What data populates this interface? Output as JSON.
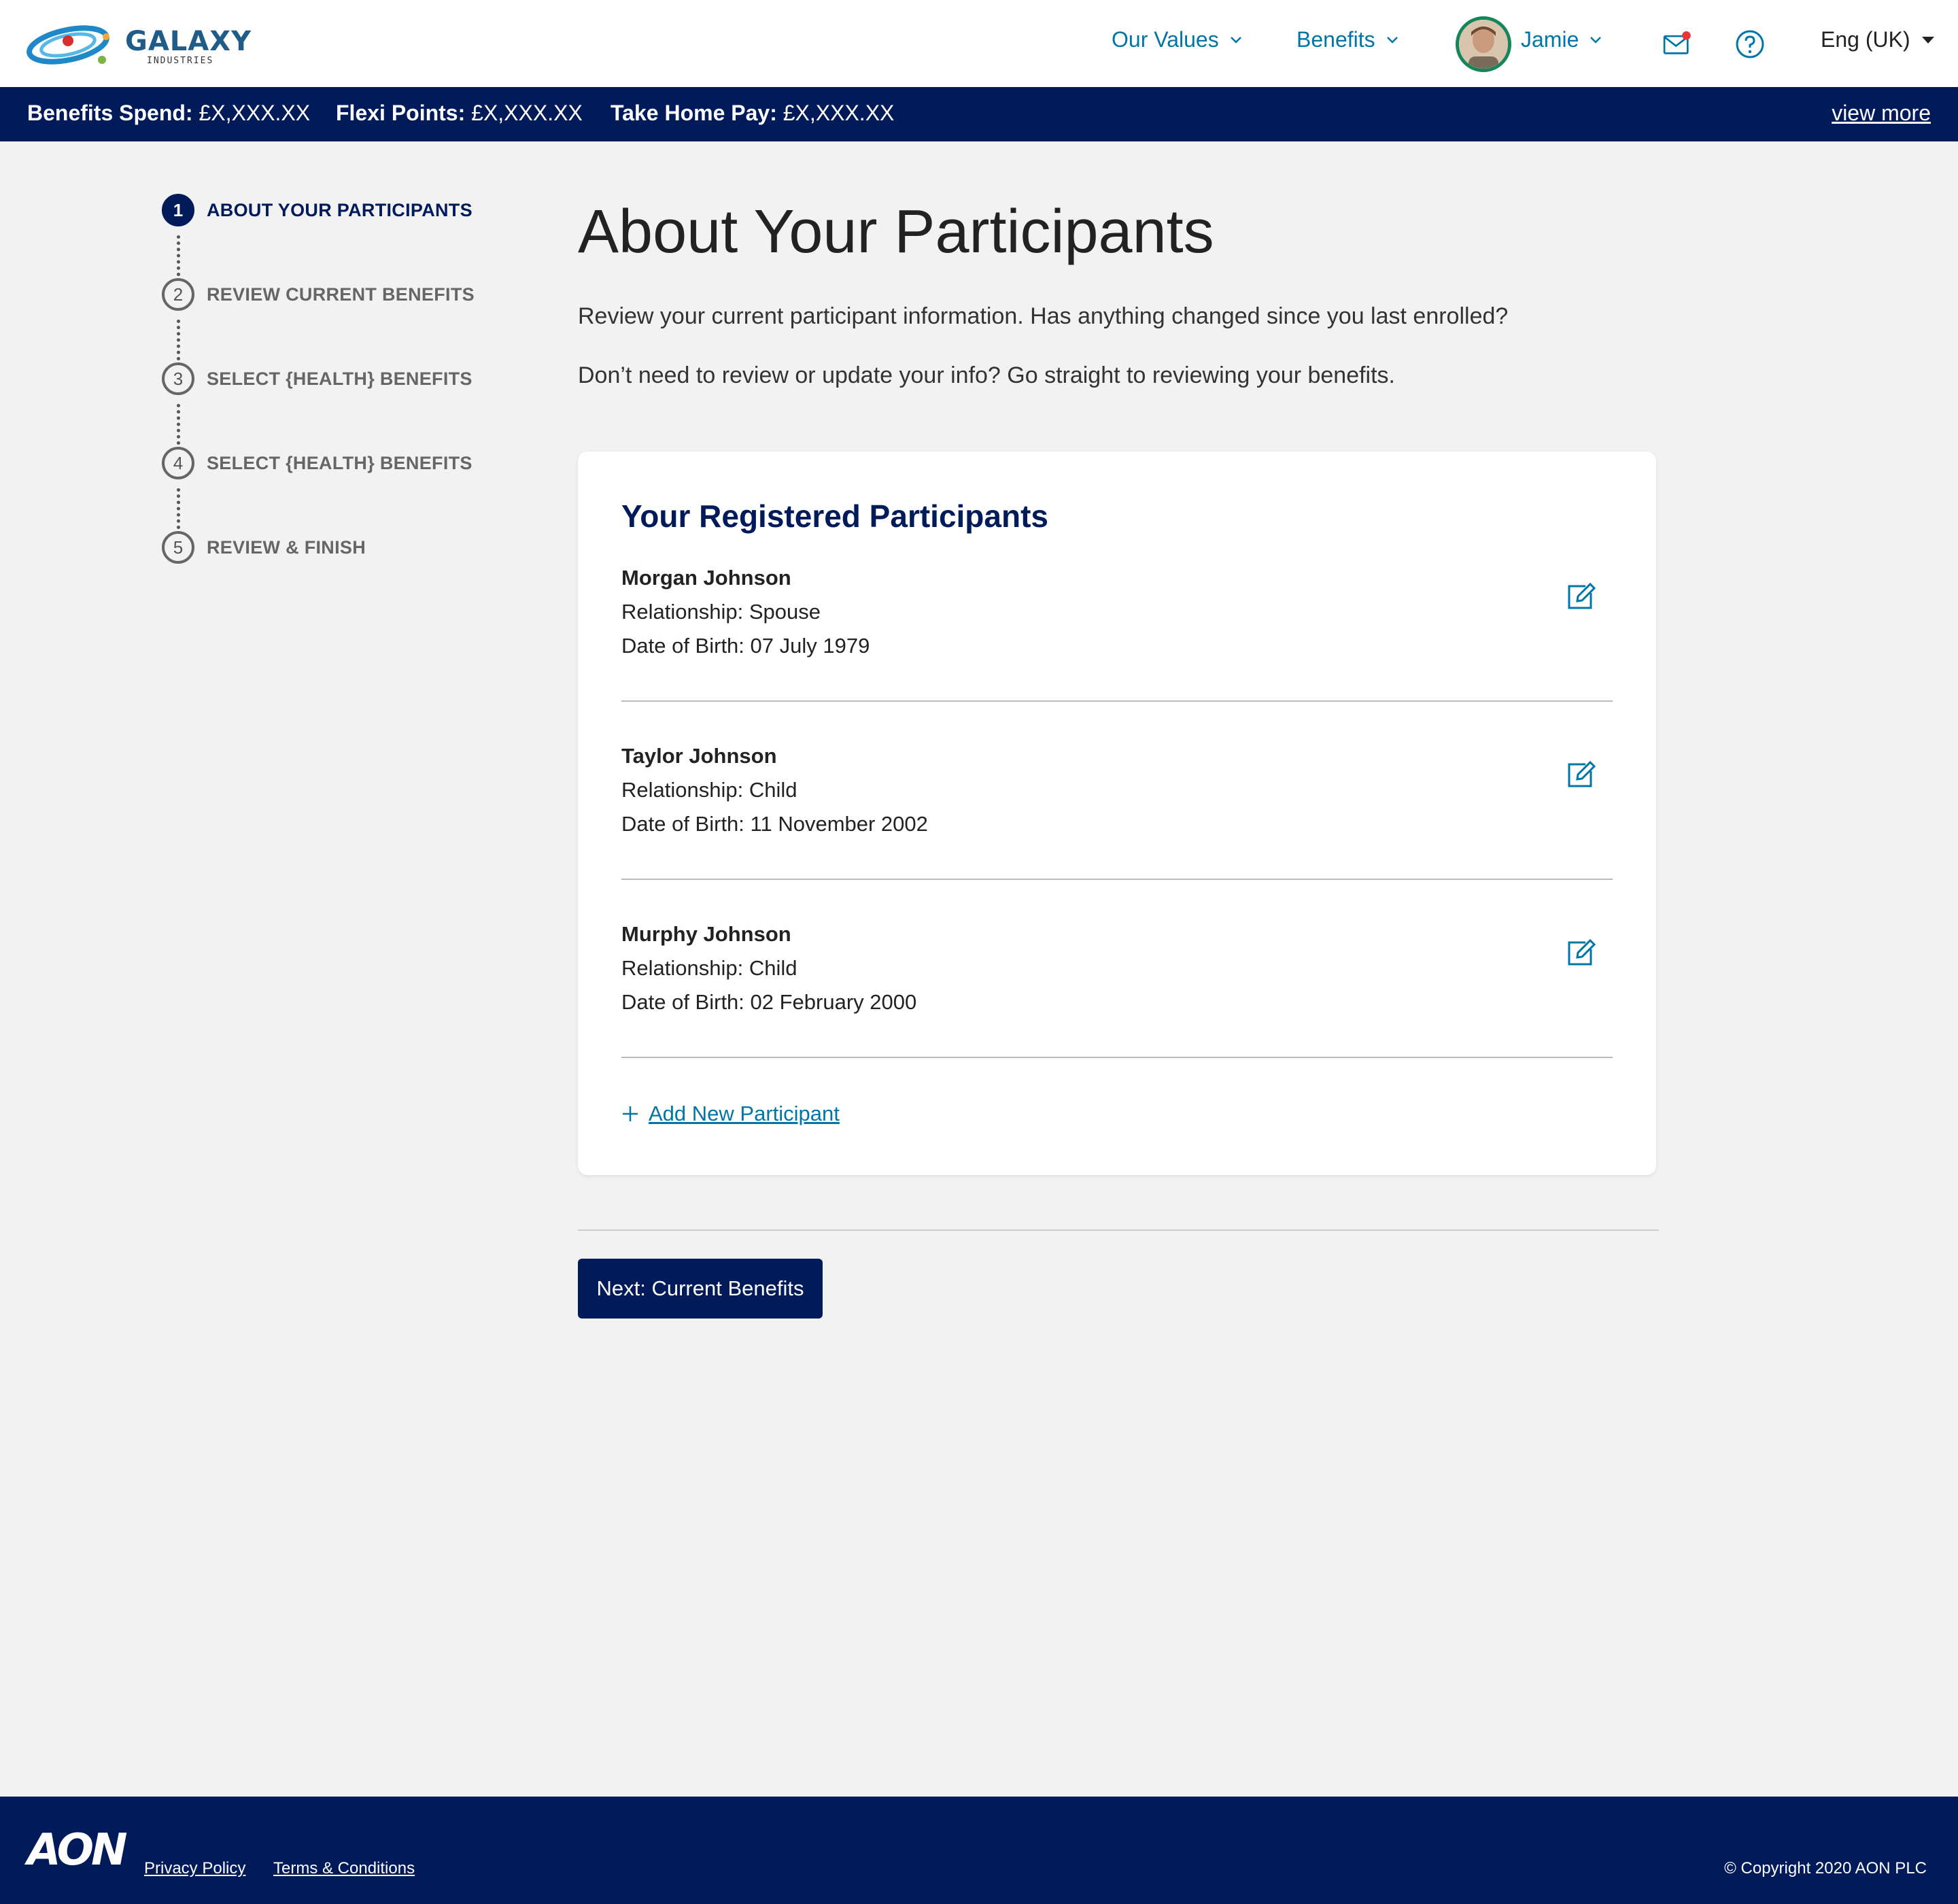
{
  "brand": {
    "name": "GALAXY",
    "sub": "INDUSTRIES"
  },
  "nav": {
    "our_values": "Our Values",
    "benefits": "Benefits",
    "user_name": "Jamie",
    "language": "Eng (UK)"
  },
  "infobar": {
    "benefits_spend_label": "Benefits Spend:",
    "benefits_spend_value": "£X,XXX.XX",
    "flexi_points_label": "Flexi Points:",
    "flexi_points_value": "£X,XXX.XX",
    "take_home_label": "Take Home Pay:",
    "take_home_value": "£X,XXX.XX",
    "view_more": "view more"
  },
  "steps": [
    {
      "number": "1",
      "label": "ABOUT YOUR PARTICIPANTS"
    },
    {
      "number": "2",
      "label": "REVIEW CURRENT BENEFITS"
    },
    {
      "number": "3",
      "label": "SELECT {HEALTH} BENEFITS"
    },
    {
      "number": "4",
      "label": "SELECT {HEALTH} BENEFITS"
    },
    {
      "number": "5",
      "label": "REVIEW & FINISH"
    }
  ],
  "main": {
    "title": "About Your Participants",
    "intro1": "Review your current participant information. Has anything changed since you last enrolled?",
    "intro2": "Don’t need to review or update your info? Go straight to reviewing your benefits.",
    "card_title": "Your Registered Participants",
    "participants": [
      {
        "name": "Morgan Johnson",
        "relationship": "Relationship: Spouse",
        "dob": "Date of Birth: 07 July 1979"
      },
      {
        "name": "Taylor Johnson",
        "relationship": "Relationship: Child",
        "dob": "Date of Birth: 11 November 2002"
      },
      {
        "name": "Murphy Johnson",
        "relationship": "Relationship: Child",
        "dob": "Date of Birth: 02 February 2000"
      }
    ],
    "add_participant": "Add New Participant",
    "next_button": "Next: Current Benefits"
  },
  "footer": {
    "logo": "AON",
    "privacy": "Privacy Policy",
    "terms": "Terms & Conditions",
    "copyright": "Copyright 2020 AON PLC"
  },
  "colors": {
    "navy": "#001a5a",
    "link_blue": "#0075a8",
    "avatar_ring": "#15865a",
    "notification": "#e53935"
  }
}
